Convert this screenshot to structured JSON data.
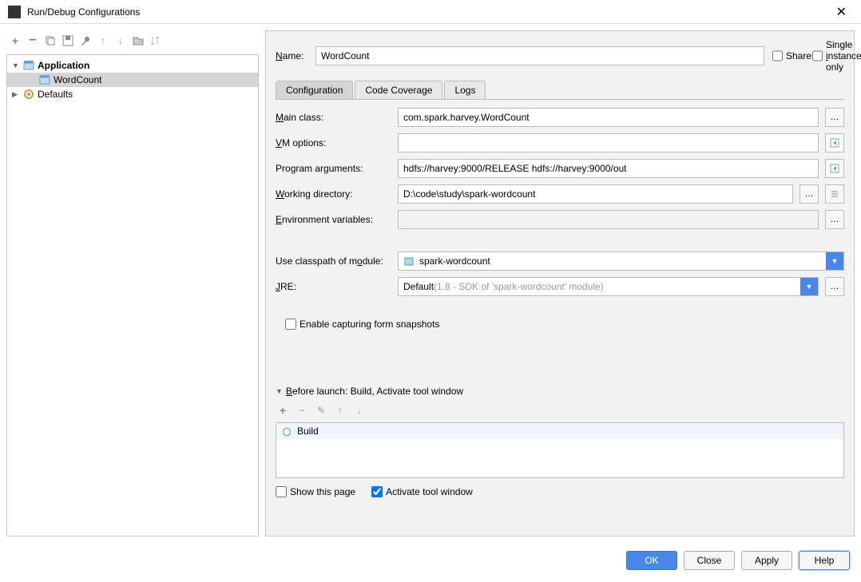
{
  "window": {
    "title": "Run/Debug Configurations"
  },
  "tree": {
    "application": {
      "label": "Application",
      "child": "WordCount"
    },
    "defaults": {
      "label": "Defaults"
    }
  },
  "name": {
    "label": "Name:",
    "value": "WordCount",
    "share": "Share",
    "single": "Single instance only"
  },
  "tabs": {
    "configuration": "Configuration",
    "coverage": "Code Coverage",
    "logs": "Logs"
  },
  "form": {
    "mainclass": {
      "label": "Main class:",
      "value": "com.spark.harvey.WordCount"
    },
    "vmoptions": {
      "label": "VM options:",
      "value": ""
    },
    "programargs": {
      "label": "Program arguments:",
      "value": "hdfs://harvey:9000/RELEASE hdfs://harvey:9000/out"
    },
    "workdir": {
      "label": "Working directory:",
      "value": "D:\\code\\study\\spark-wordcount"
    },
    "envvars": {
      "label": "Environment variables:",
      "value": ""
    },
    "classpath": {
      "label": "Use classpath of module:",
      "value": "spark-wordcount"
    },
    "jre": {
      "label": "JRE:",
      "value": "Default",
      "hint": " (1.8 - SDK of 'spark-wordcount' module)"
    },
    "snapshots": "Enable capturing form snapshots"
  },
  "before": {
    "header": "Before launch: Build, Activate tool window",
    "build": "Build",
    "showpage": "Show this page",
    "activate": "Activate tool window"
  },
  "footer": {
    "ok": "OK",
    "close": "Close",
    "apply": "Apply",
    "help": "Help"
  }
}
